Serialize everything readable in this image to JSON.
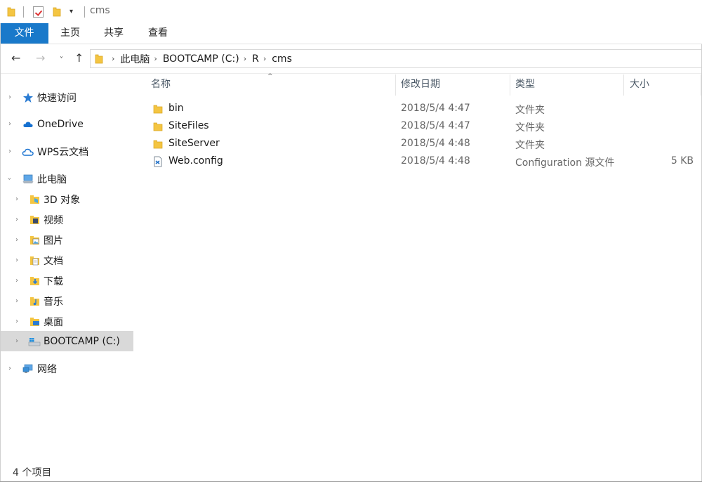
{
  "window": {
    "title": "cms"
  },
  "quick_access_toolbar": {
    "icons": [
      "folder-icon",
      "properties-icon",
      "new-folder-icon",
      "customize-dropdown-icon"
    ],
    "dropdown_glyph": "▾"
  },
  "ribbon": {
    "tabs": [
      {
        "label": "文件",
        "active": true
      },
      {
        "label": "主页"
      },
      {
        "label": "共享"
      },
      {
        "label": "查看"
      }
    ],
    "accent_color": "#1979ca"
  },
  "navigation": {
    "back_glyph": "←",
    "forward_glyph": "→",
    "recent_glyph": "˅",
    "up_glyph": "↑",
    "breadcrumb": [
      "此电脑",
      "BOOTCAMP (C:)",
      "R",
      "cms"
    ],
    "separator_glyph": "›"
  },
  "sidebar": {
    "items": [
      {
        "label": "快速访问",
        "icon": "star-icon",
        "level": 0
      },
      {
        "label": "OneDrive",
        "icon": "cloud-icon",
        "level": 0
      },
      {
        "label": "WPS云文档",
        "icon": "cloud-outline-icon",
        "level": 0
      },
      {
        "label": "此电脑",
        "icon": "computer-icon",
        "level": 0,
        "expanded": true
      },
      {
        "label": "3D 对象",
        "icon": "3d-objects-icon",
        "level": 1
      },
      {
        "label": "视频",
        "icon": "video-icon",
        "level": 1
      },
      {
        "label": "图片",
        "icon": "pictures-icon",
        "level": 1
      },
      {
        "label": "文档",
        "icon": "documents-icon",
        "level": 1
      },
      {
        "label": "下载",
        "icon": "downloads-icon",
        "level": 1
      },
      {
        "label": "音乐",
        "icon": "music-icon",
        "level": 1
      },
      {
        "label": "桌面",
        "icon": "desktop-icon",
        "level": 1
      },
      {
        "label": "BOOTCAMP (C:)",
        "icon": "drive-icon",
        "level": 1,
        "selected": true
      },
      {
        "label": "网络",
        "icon": "network-icon",
        "level": 0
      }
    ],
    "selected_color": "#d9d9d9"
  },
  "file_list": {
    "columns": [
      "名称",
      "修改日期",
      "类型",
      "大小"
    ],
    "sort_glyph": "^",
    "rows": [
      {
        "name": "bin",
        "date": "2018/5/4 4:47",
        "type": "文件夹",
        "size": "",
        "icon": "folder-icon"
      },
      {
        "name": "SiteFiles",
        "date": "2018/5/4 4:47",
        "type": "文件夹",
        "size": "",
        "icon": "folder-icon"
      },
      {
        "name": "SiteServer",
        "date": "2018/5/4 4:48",
        "type": "文件夹",
        "size": "",
        "icon": "folder-icon"
      },
      {
        "name": "Web.config",
        "date": "2018/5/4 4:48",
        "type": "Configuration 源文件",
        "size": "5 KB",
        "icon": "config-file-icon"
      }
    ]
  },
  "status_bar": {
    "item_count": "4 个项目"
  }
}
